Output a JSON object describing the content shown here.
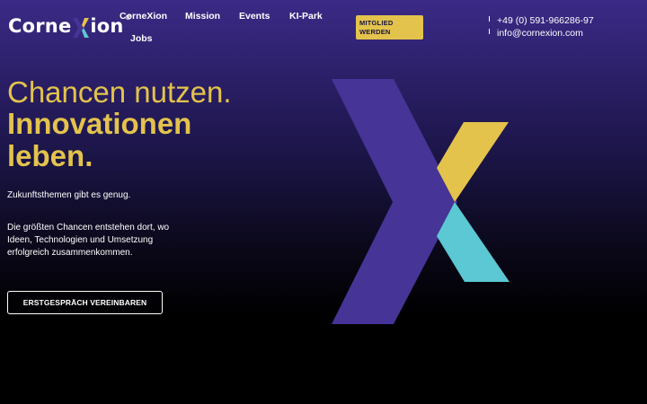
{
  "brand": {
    "name_before_x": "Corne",
    "name_after_x": "ion",
    "reg_mark": "®"
  },
  "nav": {
    "items": [
      {
        "label": "CorneXion"
      },
      {
        "label": "Mission"
      },
      {
        "label": "Events"
      },
      {
        "label": "KI-Park"
      },
      {
        "label": "Jobs"
      }
    ],
    "member_button": "MITGLIED WERDEN"
  },
  "contact": {
    "phone": "+49 (0) 591-966286-97",
    "email": "info@cornexion.com"
  },
  "hero": {
    "headline_light": "Chancen nutzen.",
    "headline_bold_1": "Innovationen",
    "headline_bold_2": "leben.",
    "intro": "Zukunftsthemen gibt es genug.",
    "description": "Die größten Chancen entstehen dort, wo Ideen, Technologien und Umsetzung erfolgreich zusammenkommen.",
    "cta": "ERSTGESPRÄCH VEREINBAREN"
  },
  "colors": {
    "accent_yellow": "#e3c34c",
    "accent_cyan": "#5bc8d3",
    "accent_purple": "#463496",
    "background_top": "#3b2a86",
    "background_bottom": "#000000"
  },
  "icons": {
    "logo_mark": "x-mark-icon",
    "hero_graphic": "x-mark-graphic"
  }
}
